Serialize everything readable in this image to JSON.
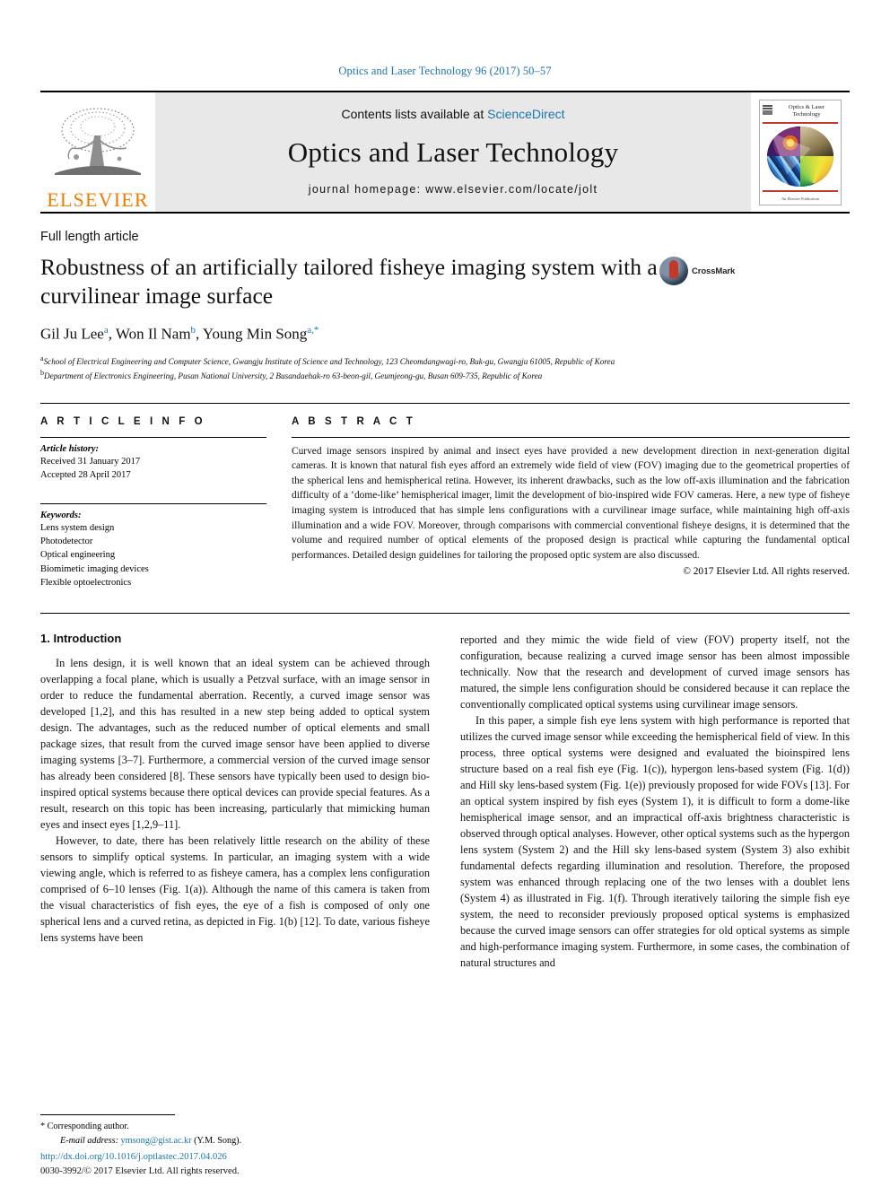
{
  "running_head": "Optics and Laser Technology 96 (2017) 50–57",
  "masthead": {
    "publisher_name": "ELSEVIER",
    "contents_prefix": "Contents lists available at ",
    "contents_link": "ScienceDirect",
    "journal_title": "Optics and Laser Technology",
    "homepage": "journal homepage: www.elsevier.com/locate/jolt",
    "cover": {
      "title": "Optics & Laser Technology",
      "footer": "An Elsevier Publication"
    }
  },
  "article": {
    "type": "Full length article",
    "title": "Robustness of an artificially tailored fisheye imaging system with a curvilinear image surface",
    "crossmark_label": "CrossMark",
    "authors": [
      {
        "name": "Gil Ju Lee",
        "marks": "a"
      },
      {
        "name": "Won Il Nam",
        "marks": "b"
      },
      {
        "name": "Young Min Song",
        "marks": "a,*"
      }
    ],
    "affiliations": [
      {
        "mark": "a",
        "text": "School of Electrical Engineering and Computer Science, Gwangju Institute of Science and Technology, 123 Cheomdangwagi-ro, Buk-gu, Gwangju 61005, Republic of Korea"
      },
      {
        "mark": "b",
        "text": "Department of Electronics Engineering, Pusan National University, 2 Busandaehak-ro 63-beon-gil, Geumjeong-gu, Busan 609-735, Republic of Korea"
      }
    ]
  },
  "article_info": {
    "heading": "A R T I C L E   I N F O",
    "history_label": "Article history:",
    "history": [
      "Received 31 January 2017",
      "Accepted 28 April 2017"
    ],
    "keywords_label": "Keywords:",
    "keywords": [
      "Lens system design",
      "Photodetector",
      "Optical engineering",
      "Biomimetic imaging devices",
      "Flexible optoelectronics"
    ]
  },
  "abstract": {
    "heading": "A B S T R A C T",
    "text": "Curved image sensors inspired by animal and insect eyes have provided a new development direction in next-generation digital cameras. It is known that natural fish eyes afford an extremely wide field of view (FOV) imaging due to the geometrical properties of the spherical lens and hemispherical retina. However, its inherent drawbacks, such as the low off-axis illumination and the fabrication difficulty of a ‘dome-like’ hemispherical imager, limit the development of bio-inspired wide FOV cameras. Here, a new type of fisheye imaging system is introduced that has simple lens configurations with a curvilinear image surface, while maintaining high off-axis illumination and a wide FOV. Moreover, through comparisons with commercial conventional fisheye designs, it is determined that the volume and required number of optical elements of the proposed design is practical while capturing the fundamental optical performances. Detailed design guidelines for tailoring the proposed optic system are also discussed.",
    "copyright": "© 2017 Elsevier Ltd. All rights reserved."
  },
  "body": {
    "section_heading": "1. Introduction",
    "left_paragraphs": [
      "In lens design, it is well known that an ideal system can be achieved through overlapping a focal plane, which is usually a Petzval surface, with an image sensor in order to reduce the fundamental aberration. Recently, a curved image sensor was developed [1,2], and this has resulted in a new step being added to optical system design. The advantages, such as the reduced number of optical elements and small package sizes, that result from the curved image sensor have been applied to diverse imaging systems [3–7]. Furthermore, a commercial version of the curved image sensor has already been considered [8]. These sensors have typically been used to design bio-inspired optical systems because there optical devices can provide special features. As a result, research on this topic has been increasing, particularly that mimicking human eyes and insect eyes [1,2,9–11].",
      "However, to date, there has been relatively little research on the ability of these sensors to simplify optical systems. In particular, an imaging system with a wide viewing angle, which is referred to as fisheye camera, has a complex lens configuration comprised of 6–10 lenses (Fig. 1(a)). Although the name of this camera is taken from the visual characteristics of fish eyes, the eye of a fish is composed of only one spherical lens and a curved retina, as depicted in Fig. 1(b) [12]. To date, various fisheye lens systems have been"
    ],
    "right_paragraphs": [
      "reported and they mimic the wide field of view (FOV) property itself, not the configuration, because realizing a curved image sensor has been almost impossible technically. Now that the research and development of curved image sensors has matured, the simple lens configuration should be considered because it can replace the conventionally complicated optical systems using curvilinear image sensors.",
      "In this paper, a simple fish eye lens system with high performance is reported that utilizes the curved image sensor while exceeding the hemispherical field of view. In this process, three optical systems were designed and evaluated the bioinspired lens structure based on a real fish eye (Fig. 1(c)), hypergon lens-based system (Fig. 1(d)) and Hill sky lens-based system (Fig. 1(e)) previously proposed for wide FOVs [13]. For an optical system inspired by fish eyes (System 1), it is difficult to form a dome-like hemispherical image sensor, and an impractical off-axis brightness characteristic is observed through optical analyses. However, other optical systems such as the hypergon lens system (System 2) and the Hill sky lens-based system (System 3) also exhibit fundamental defects regarding illumination and resolution. Therefore, the proposed system was enhanced through replacing one of the two lenses with a doublet lens (System 4) as illustrated in Fig. 1(f). Through iteratively tailoring the simple fish eye system, the need to reconsider previously proposed optical systems is emphasized because the curved image sensors can offer strategies for old optical systems as simple and high-performance imaging system. Furthermore, in some cases, the combination of natural structures and"
    ]
  },
  "footer": {
    "corresponding_marker": "*",
    "corresponding_text": "Corresponding author.",
    "email_label": "E-mail address:",
    "email": "ymsong@gist.ac.kr",
    "email_suffix": "(Y.M. Song).",
    "doi": "http://dx.doi.org/10.1016/j.optlastec.2017.04.026",
    "issn_line": "0030-3992/© 2017 Elsevier Ltd. All rights reserved."
  },
  "colors": {
    "link": "#1a76a8",
    "elsevier_orange": "#f07d00",
    "masthead_grey": "#e8e8e8"
  }
}
